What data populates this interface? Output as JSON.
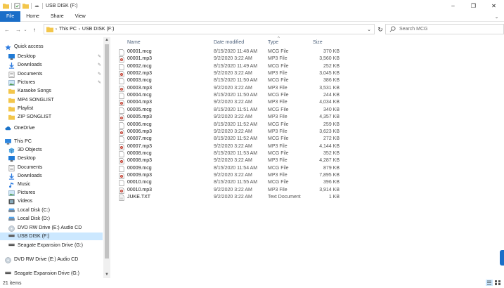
{
  "window": {
    "title": "USB DISK (F:)",
    "controls": {
      "minimize": "–",
      "maximize": "❐",
      "close": "✕"
    }
  },
  "ribbon": {
    "tabs": [
      "File",
      "Home",
      "Share",
      "View"
    ],
    "expand": "⌄"
  },
  "addressbar": {
    "back": "←",
    "forward": "→",
    "recent": "⌄",
    "up": "↑",
    "crumbs": [
      "This PC",
      "USB DISK (F:)"
    ],
    "dropdown": "⌄",
    "refresh": "↻"
  },
  "search": {
    "placeholder": "Search MCG"
  },
  "navpane": {
    "items": [
      {
        "label": "Quick access",
        "icon": "star-icon",
        "pinned": false
      },
      {
        "label": "Desktop",
        "icon": "desktop-icon",
        "pinned": true
      },
      {
        "label": "Downloads",
        "icon": "download-icon",
        "pinned": true
      },
      {
        "label": "Documents",
        "icon": "documents-icon",
        "pinned": true
      },
      {
        "label": "Pictures",
        "icon": "pictures-icon",
        "pinned": true
      },
      {
        "label": "Karaoke Songs",
        "icon": "folder-icon",
        "pinned": false
      },
      {
        "label": "MP4 SONGLIST",
        "icon": "folder-icon",
        "pinned": false
      },
      {
        "label": "Playlist",
        "icon": "folder-icon",
        "pinned": false
      },
      {
        "label": "ZIP SONGLIST",
        "icon": "folder-icon",
        "pinned": false
      },
      {
        "label": "OneDrive",
        "icon": "cloud-icon",
        "pinned": false
      },
      {
        "label": "This PC",
        "icon": "pc-icon",
        "pinned": false
      },
      {
        "label": "3D Objects",
        "icon": "cube-icon",
        "pinned": false
      },
      {
        "label": "Desktop",
        "icon": "desktop-icon",
        "pinned": false
      },
      {
        "label": "Documents",
        "icon": "documents-icon",
        "pinned": false
      },
      {
        "label": "Downloads",
        "icon": "download-icon",
        "pinned": false
      },
      {
        "label": "Music",
        "icon": "music-icon",
        "pinned": false
      },
      {
        "label": "Pictures",
        "icon": "pictures-icon",
        "pinned": false
      },
      {
        "label": "Videos",
        "icon": "videos-icon",
        "pinned": false
      },
      {
        "label": "Local Disk (C:)",
        "icon": "drive-icon",
        "pinned": false
      },
      {
        "label": "Local Disk (D:)",
        "icon": "drive-icon",
        "pinned": false
      },
      {
        "label": "DVD RW Drive (E:) Audio CD",
        "icon": "cd-icon",
        "pinned": false
      },
      {
        "label": "USB DISK (F:)",
        "icon": "usb-icon",
        "pinned": false,
        "selected": true
      },
      {
        "label": "Seagate Expansion Drive (G:)",
        "icon": "usb-icon",
        "pinned": false
      },
      {
        "label": "DVD RW Drive (E:) Audio CD",
        "icon": "cd-icon",
        "pinned": false
      },
      {
        "label": "Seagate Expansion Drive (G:)",
        "icon": "usb-icon",
        "pinned": false
      }
    ],
    "pin_glyph": "✎",
    "scroll_up": "▲",
    "scroll_down": "▼"
  },
  "filelist": {
    "columns": {
      "name": "Name",
      "date": "Date modified",
      "type": "Type",
      "size": "Size"
    },
    "sort_glyph": "^",
    "rows": [
      {
        "name": "00001.mcg",
        "date": "8/15/2020 11:48 AM",
        "type": "MCG File",
        "size": "370 KB",
        "kind": "mcg"
      },
      {
        "name": "00001.mp3",
        "date": "9/2/2020 3:22 AM",
        "type": "MP3 File",
        "size": "3,560 KB",
        "kind": "mp3"
      },
      {
        "name": "00002.mcg",
        "date": "8/15/2020 11:49 AM",
        "type": "MCG File",
        "size": "252 KB",
        "kind": "mcg"
      },
      {
        "name": "00002.mp3",
        "date": "9/2/2020 3:22 AM",
        "type": "MP3 File",
        "size": "3,045 KB",
        "kind": "mp3"
      },
      {
        "name": "00003.mcg",
        "date": "8/15/2020 11:50 AM",
        "type": "MCG File",
        "size": "386 KB",
        "kind": "mcg"
      },
      {
        "name": "00003.mp3",
        "date": "9/2/2020 3:22 AM",
        "type": "MP3 File",
        "size": "3,531 KB",
        "kind": "mp3"
      },
      {
        "name": "00004.mcg",
        "date": "8/15/2020 11:50 AM",
        "type": "MCG File",
        "size": "244 KB",
        "kind": "mcg"
      },
      {
        "name": "00004.mp3",
        "date": "9/2/2020 3:22 AM",
        "type": "MP3 File",
        "size": "4,034 KB",
        "kind": "mp3"
      },
      {
        "name": "00005.mcg",
        "date": "8/15/2020 11:51 AM",
        "type": "MCG File",
        "size": "340 KB",
        "kind": "mcg"
      },
      {
        "name": "00005.mp3",
        "date": "9/2/2020 3:22 AM",
        "type": "MP3 File",
        "size": "4,357 KB",
        "kind": "mp3"
      },
      {
        "name": "00006.mcg",
        "date": "8/15/2020 11:52 AM",
        "type": "MCG File",
        "size": "259 KB",
        "kind": "mcg"
      },
      {
        "name": "00006.mp3",
        "date": "9/2/2020 3:22 AM",
        "type": "MP3 File",
        "size": "3,623 KB",
        "kind": "mp3"
      },
      {
        "name": "00007.mcg",
        "date": "8/15/2020 11:52 AM",
        "type": "MCG File",
        "size": "272 KB",
        "kind": "mcg"
      },
      {
        "name": "00007.mp3",
        "date": "9/2/2020 3:22 AM",
        "type": "MP3 File",
        "size": "4,144 KB",
        "kind": "mp3"
      },
      {
        "name": "00008.mcg",
        "date": "8/15/2020 11:53 AM",
        "type": "MCG File",
        "size": "352 KB",
        "kind": "mcg"
      },
      {
        "name": "00008.mp3",
        "date": "9/2/2020 3:22 AM",
        "type": "MP3 File",
        "size": "4,287 KB",
        "kind": "mp3"
      },
      {
        "name": "00009.mcg",
        "date": "8/15/2020 11:54 AM",
        "type": "MCG File",
        "size": "879 KB",
        "kind": "mcg"
      },
      {
        "name": "00009.mp3",
        "date": "9/2/2020 3:22 AM",
        "type": "MP3 File",
        "size": "7,895 KB",
        "kind": "mp3"
      },
      {
        "name": "00010.mcg",
        "date": "8/15/2020 11:55 AM",
        "type": "MCG File",
        "size": "396 KB",
        "kind": "mcg"
      },
      {
        "name": "00010.mp3",
        "date": "9/2/2020 3:22 AM",
        "type": "MP3 File",
        "size": "3,914 KB",
        "kind": "mp3"
      },
      {
        "name": "JUKE.TXT",
        "date": "9/2/2020 3:22 AM",
        "type": "Text Document",
        "size": "1 KB",
        "kind": "txt"
      }
    ]
  },
  "statusbar": {
    "count": "21 items"
  },
  "colors": {
    "accent": "#1a6ec8",
    "selected": "#cce8ff",
    "folder": "#f3c64b",
    "header_text": "#4c607a"
  }
}
